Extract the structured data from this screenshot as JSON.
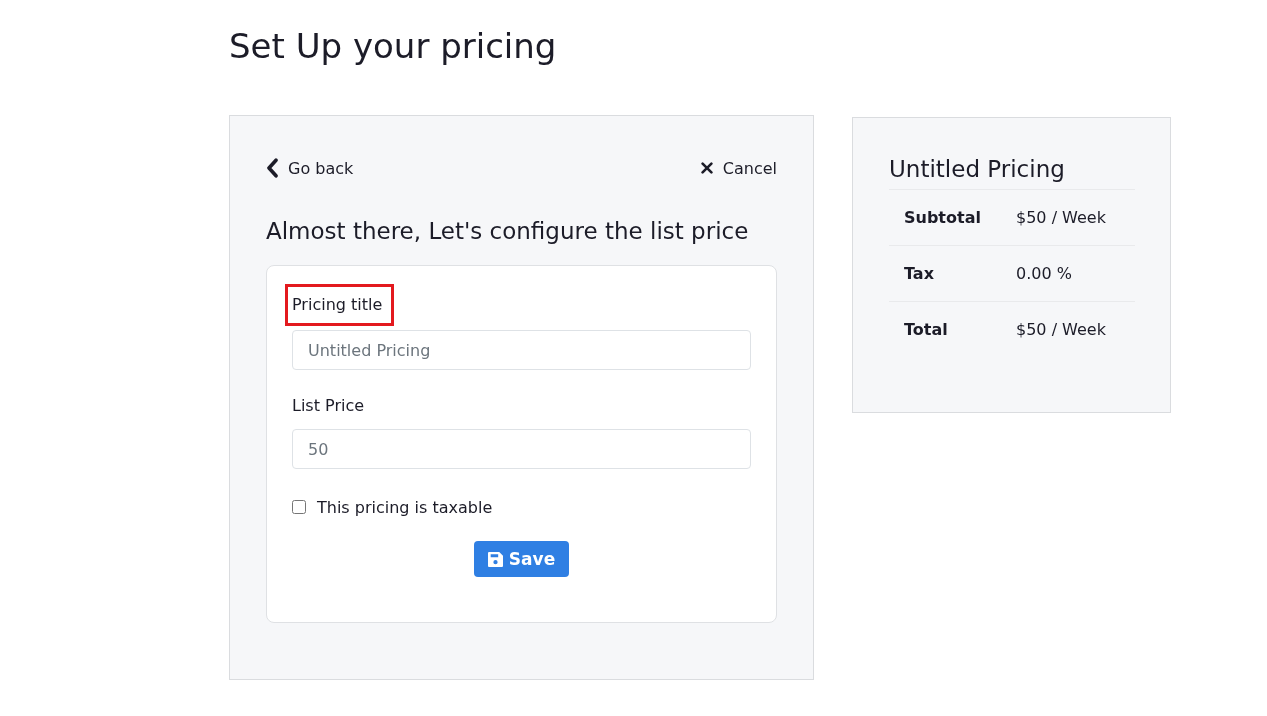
{
  "page": {
    "title": "Set Up your pricing"
  },
  "editor": {
    "back_link": "Go back",
    "cancel_link": "Cancel",
    "heading": "Almost there, Let's configure the list price",
    "fields": [
      {
        "label": "Pricing title",
        "placeholder": "Untitled Pricing",
        "highlighted": true
      },
      {
        "label": "List Price",
        "placeholder": "50",
        "highlighted": false
      }
    ],
    "taxable": {
      "label": "This pricing is taxable",
      "checked": false
    },
    "save_button": "Save"
  },
  "summary": {
    "title": "Untitled Pricing",
    "rows": [
      {
        "label": "Subtotal",
        "value": "$50 / Week"
      },
      {
        "label": "Tax",
        "value": "0.00 %"
      },
      {
        "label": "Total",
        "value": "$50 / Week"
      }
    ]
  }
}
